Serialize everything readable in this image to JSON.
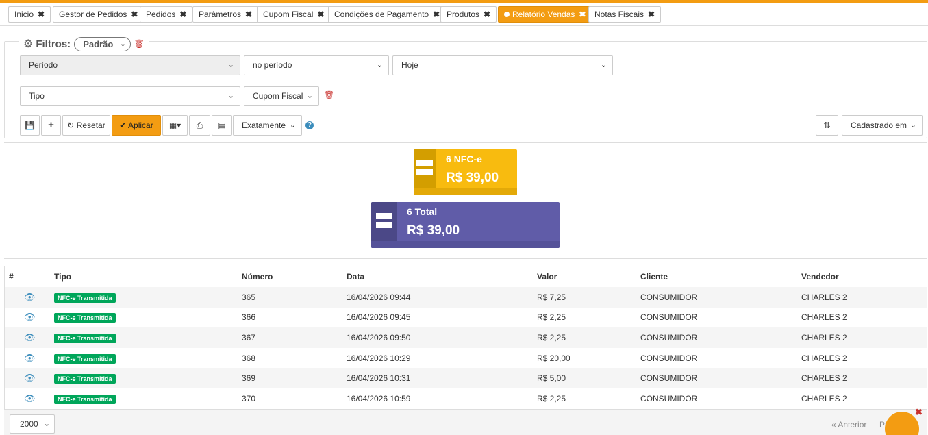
{
  "tabs": [
    {
      "label": "Inicio",
      "active": false
    },
    {
      "label": "Gestor de Pedidos",
      "active": false
    },
    {
      "label": "Pedidos",
      "active": false
    },
    {
      "label": "Parâmetros",
      "active": false
    },
    {
      "label": "Cupom Fiscal",
      "active": false
    },
    {
      "label": "Condições de Pagamento",
      "active": false
    },
    {
      "label": "Produtos",
      "active": false
    },
    {
      "label": "Relatório Vendas",
      "active": true
    },
    {
      "label": "Notas Fiscais",
      "active": false
    }
  ],
  "filters": {
    "title": "Filtros:",
    "preset": "Padrão",
    "row1": {
      "field": "Período",
      "operator": "no período",
      "value": "Hoje"
    },
    "row2": {
      "field": "Tipo",
      "value": "Cupom Fiscal"
    }
  },
  "toolbar": {
    "reset_label": "Resetar",
    "apply_label": "Aplicar",
    "match_mode": "Exatamente",
    "sort_by": "Cadastrado em"
  },
  "summary": [
    {
      "count_label": "6 NFC-e",
      "amount": "R$ 39,00",
      "color": "#f8bb0f"
    },
    {
      "count_label": "6 Total",
      "amount": "R$ 39,00",
      "color": "#605ca8"
    }
  ],
  "table": {
    "columns": [
      "#",
      "Tipo",
      "Número",
      "Data",
      "Valor",
      "Cliente",
      "Vendedor"
    ],
    "rows": [
      {
        "tipo": "NFC-e Transmitida",
        "numero": "365",
        "data": "16/04/2026 09:44",
        "valor": "R$ 7,25",
        "cliente": "CONSUMIDOR",
        "vendedor": "CHARLES 2"
      },
      {
        "tipo": "NFC-e Transmitida",
        "numero": "366",
        "data": "16/04/2026 09:45",
        "valor": "R$ 2,25",
        "cliente": "CONSUMIDOR",
        "vendedor": "CHARLES 2"
      },
      {
        "tipo": "NFC-e Transmitida",
        "numero": "367",
        "data": "16/04/2026 09:50",
        "valor": "R$ 2,25",
        "cliente": "CONSUMIDOR",
        "vendedor": "CHARLES 2"
      },
      {
        "tipo": "NFC-e Transmitida",
        "numero": "368",
        "data": "16/04/2026 10:29",
        "valor": "R$ 20,00",
        "cliente": "CONSUMIDOR",
        "vendedor": "CHARLES 2"
      },
      {
        "tipo": "NFC-e Transmitida",
        "numero": "369",
        "data": "16/04/2026 10:31",
        "valor": "R$ 5,00",
        "cliente": "CONSUMIDOR",
        "vendedor": "CHARLES 2"
      },
      {
        "tipo": "NFC-e Transmitida",
        "numero": "370",
        "data": "16/04/2026 10:59",
        "valor": "R$ 2,25",
        "cliente": "CONSUMIDOR",
        "vendedor": "CHARLES 2"
      }
    ]
  },
  "pagination": {
    "page_size": "2000",
    "prev_label": "« Anterior",
    "next_label": "Pr"
  },
  "colors": {
    "accent": "#f39c12",
    "success": "#00a65a",
    "link": "#3c8dbc",
    "danger": "#c9302c"
  }
}
